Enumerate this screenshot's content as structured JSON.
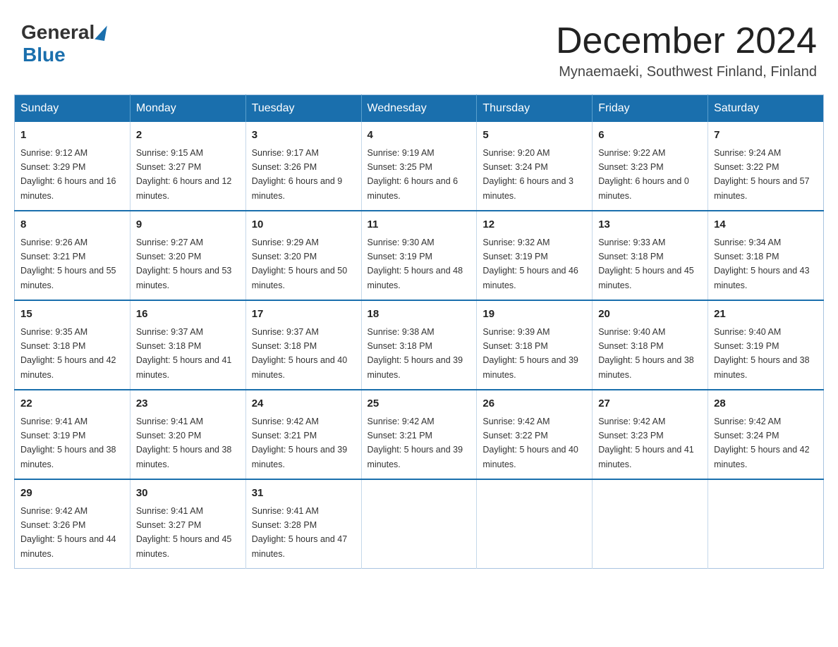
{
  "header": {
    "logo": {
      "general": "General",
      "blue": "Blue",
      "subtitle": "Blue"
    },
    "title": "December 2024",
    "location": "Mynaemaeki, Southwest Finland, Finland"
  },
  "weekdays": [
    "Sunday",
    "Monday",
    "Tuesday",
    "Wednesday",
    "Thursday",
    "Friday",
    "Saturday"
  ],
  "weeks": [
    [
      {
        "day": "1",
        "sunrise": "9:12 AM",
        "sunset": "3:29 PM",
        "daylight": "6 hours and 16 minutes."
      },
      {
        "day": "2",
        "sunrise": "9:15 AM",
        "sunset": "3:27 PM",
        "daylight": "6 hours and 12 minutes."
      },
      {
        "day": "3",
        "sunrise": "9:17 AM",
        "sunset": "3:26 PM",
        "daylight": "6 hours and 9 minutes."
      },
      {
        "day": "4",
        "sunrise": "9:19 AM",
        "sunset": "3:25 PM",
        "daylight": "6 hours and 6 minutes."
      },
      {
        "day": "5",
        "sunrise": "9:20 AM",
        "sunset": "3:24 PM",
        "daylight": "6 hours and 3 minutes."
      },
      {
        "day": "6",
        "sunrise": "9:22 AM",
        "sunset": "3:23 PM",
        "daylight": "6 hours and 0 minutes."
      },
      {
        "day": "7",
        "sunrise": "9:24 AM",
        "sunset": "3:22 PM",
        "daylight": "5 hours and 57 minutes."
      }
    ],
    [
      {
        "day": "8",
        "sunrise": "9:26 AM",
        "sunset": "3:21 PM",
        "daylight": "5 hours and 55 minutes."
      },
      {
        "day": "9",
        "sunrise": "9:27 AM",
        "sunset": "3:20 PM",
        "daylight": "5 hours and 53 minutes."
      },
      {
        "day": "10",
        "sunrise": "9:29 AM",
        "sunset": "3:20 PM",
        "daylight": "5 hours and 50 minutes."
      },
      {
        "day": "11",
        "sunrise": "9:30 AM",
        "sunset": "3:19 PM",
        "daylight": "5 hours and 48 minutes."
      },
      {
        "day": "12",
        "sunrise": "9:32 AM",
        "sunset": "3:19 PM",
        "daylight": "5 hours and 46 minutes."
      },
      {
        "day": "13",
        "sunrise": "9:33 AM",
        "sunset": "3:18 PM",
        "daylight": "5 hours and 45 minutes."
      },
      {
        "day": "14",
        "sunrise": "9:34 AM",
        "sunset": "3:18 PM",
        "daylight": "5 hours and 43 minutes."
      }
    ],
    [
      {
        "day": "15",
        "sunrise": "9:35 AM",
        "sunset": "3:18 PM",
        "daylight": "5 hours and 42 minutes."
      },
      {
        "day": "16",
        "sunrise": "9:37 AM",
        "sunset": "3:18 PM",
        "daylight": "5 hours and 41 minutes."
      },
      {
        "day": "17",
        "sunrise": "9:37 AM",
        "sunset": "3:18 PM",
        "daylight": "5 hours and 40 minutes."
      },
      {
        "day": "18",
        "sunrise": "9:38 AM",
        "sunset": "3:18 PM",
        "daylight": "5 hours and 39 minutes."
      },
      {
        "day": "19",
        "sunrise": "9:39 AM",
        "sunset": "3:18 PM",
        "daylight": "5 hours and 39 minutes."
      },
      {
        "day": "20",
        "sunrise": "9:40 AM",
        "sunset": "3:18 PM",
        "daylight": "5 hours and 38 minutes."
      },
      {
        "day": "21",
        "sunrise": "9:40 AM",
        "sunset": "3:19 PM",
        "daylight": "5 hours and 38 minutes."
      }
    ],
    [
      {
        "day": "22",
        "sunrise": "9:41 AM",
        "sunset": "3:19 PM",
        "daylight": "5 hours and 38 minutes."
      },
      {
        "day": "23",
        "sunrise": "9:41 AM",
        "sunset": "3:20 PM",
        "daylight": "5 hours and 38 minutes."
      },
      {
        "day": "24",
        "sunrise": "9:42 AM",
        "sunset": "3:21 PM",
        "daylight": "5 hours and 39 minutes."
      },
      {
        "day": "25",
        "sunrise": "9:42 AM",
        "sunset": "3:21 PM",
        "daylight": "5 hours and 39 minutes."
      },
      {
        "day": "26",
        "sunrise": "9:42 AM",
        "sunset": "3:22 PM",
        "daylight": "5 hours and 40 minutes."
      },
      {
        "day": "27",
        "sunrise": "9:42 AM",
        "sunset": "3:23 PM",
        "daylight": "5 hours and 41 minutes."
      },
      {
        "day": "28",
        "sunrise": "9:42 AM",
        "sunset": "3:24 PM",
        "daylight": "5 hours and 42 minutes."
      }
    ],
    [
      {
        "day": "29",
        "sunrise": "9:42 AM",
        "sunset": "3:26 PM",
        "daylight": "5 hours and 44 minutes."
      },
      {
        "day": "30",
        "sunrise": "9:41 AM",
        "sunset": "3:27 PM",
        "daylight": "5 hours and 45 minutes."
      },
      {
        "day": "31",
        "sunrise": "9:41 AM",
        "sunset": "3:28 PM",
        "daylight": "5 hours and 47 minutes."
      },
      null,
      null,
      null,
      null
    ]
  ]
}
